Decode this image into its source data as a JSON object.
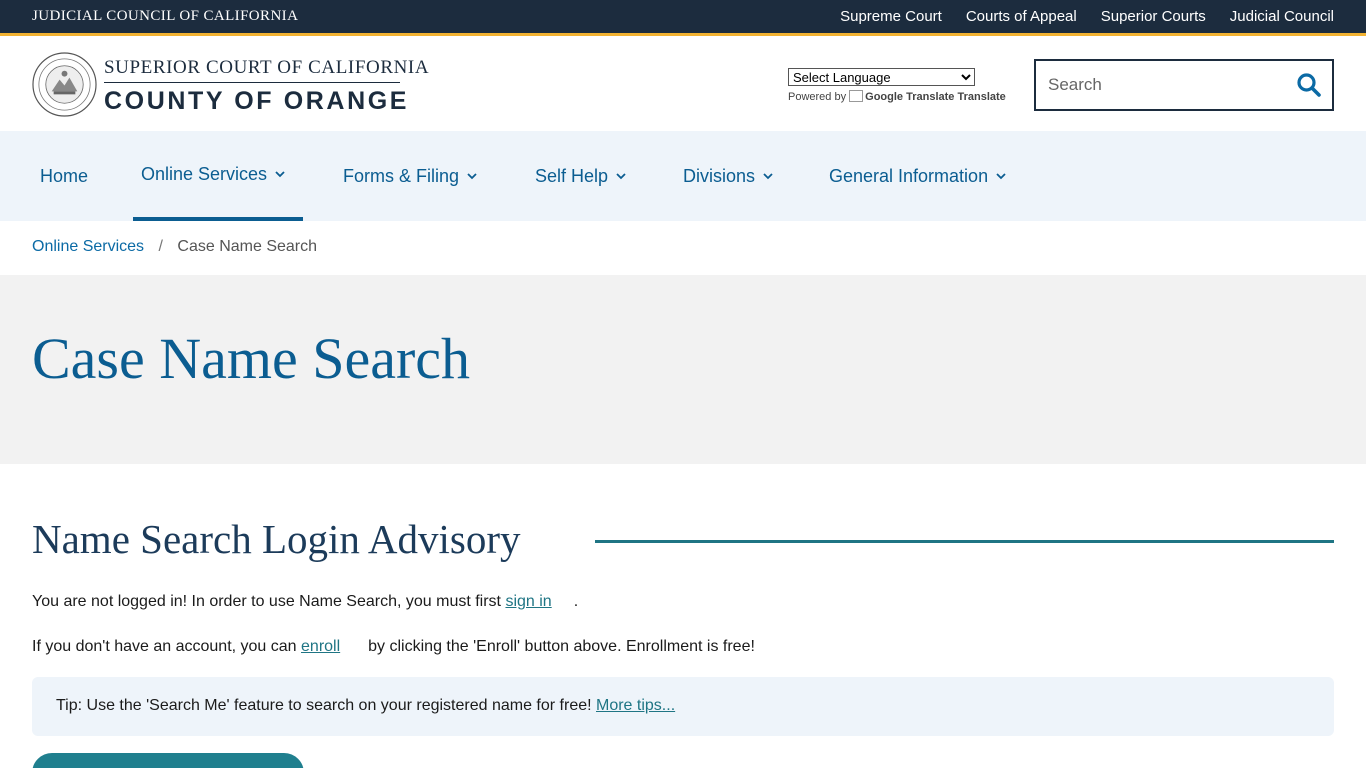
{
  "topbar": {
    "org": "JUDICIAL COUNCIL OF CALIFORNIA",
    "links": [
      "Supreme Court",
      "Courts of Appeal",
      "Superior Courts",
      "Judicial Council"
    ]
  },
  "header": {
    "court_line1": "SUPERIOR COURT OF CALIFORNIA",
    "court_line2": "COUNTY OF ORANGE",
    "language_select": "Select Language",
    "powered_by": "Powered by",
    "google_translate": "Google Translate",
    "translate": "Translate",
    "search_placeholder": "Search"
  },
  "nav": {
    "items": [
      {
        "label": "Home"
      },
      {
        "label": "Online Services"
      },
      {
        "label": "Forms & Filing"
      },
      {
        "label": "Self Help"
      },
      {
        "label": "Divisions"
      },
      {
        "label": "General Information"
      }
    ],
    "active": "Online Services"
  },
  "breadcrumb": {
    "parent": "Online Services",
    "separator": "/",
    "current": "Case Name Search"
  },
  "hero": {
    "title": "Case Name Search"
  },
  "content": {
    "heading": "Name Search Login Advisory",
    "p1_text": "You are not logged in! In order to use Name Search, you must first ",
    "p1_link": "sign in",
    "p1_end": ".",
    "p2_text": "If you don't have an account, you can ",
    "p2_link": "enroll",
    "p2_end": "by clicking the 'Enroll' button above. Enrollment is free!",
    "tip_text": "Tip: Use the 'Search Me' feature to search on your registered name for free! ",
    "tip_link": "More tips..."
  },
  "colors": {
    "topbar_bg": "#1c2c3e",
    "topbar_accent": "#f2b231",
    "nav_bg": "#eef4fa",
    "link_blue": "#0b5d91",
    "teal": "#1f7584"
  }
}
